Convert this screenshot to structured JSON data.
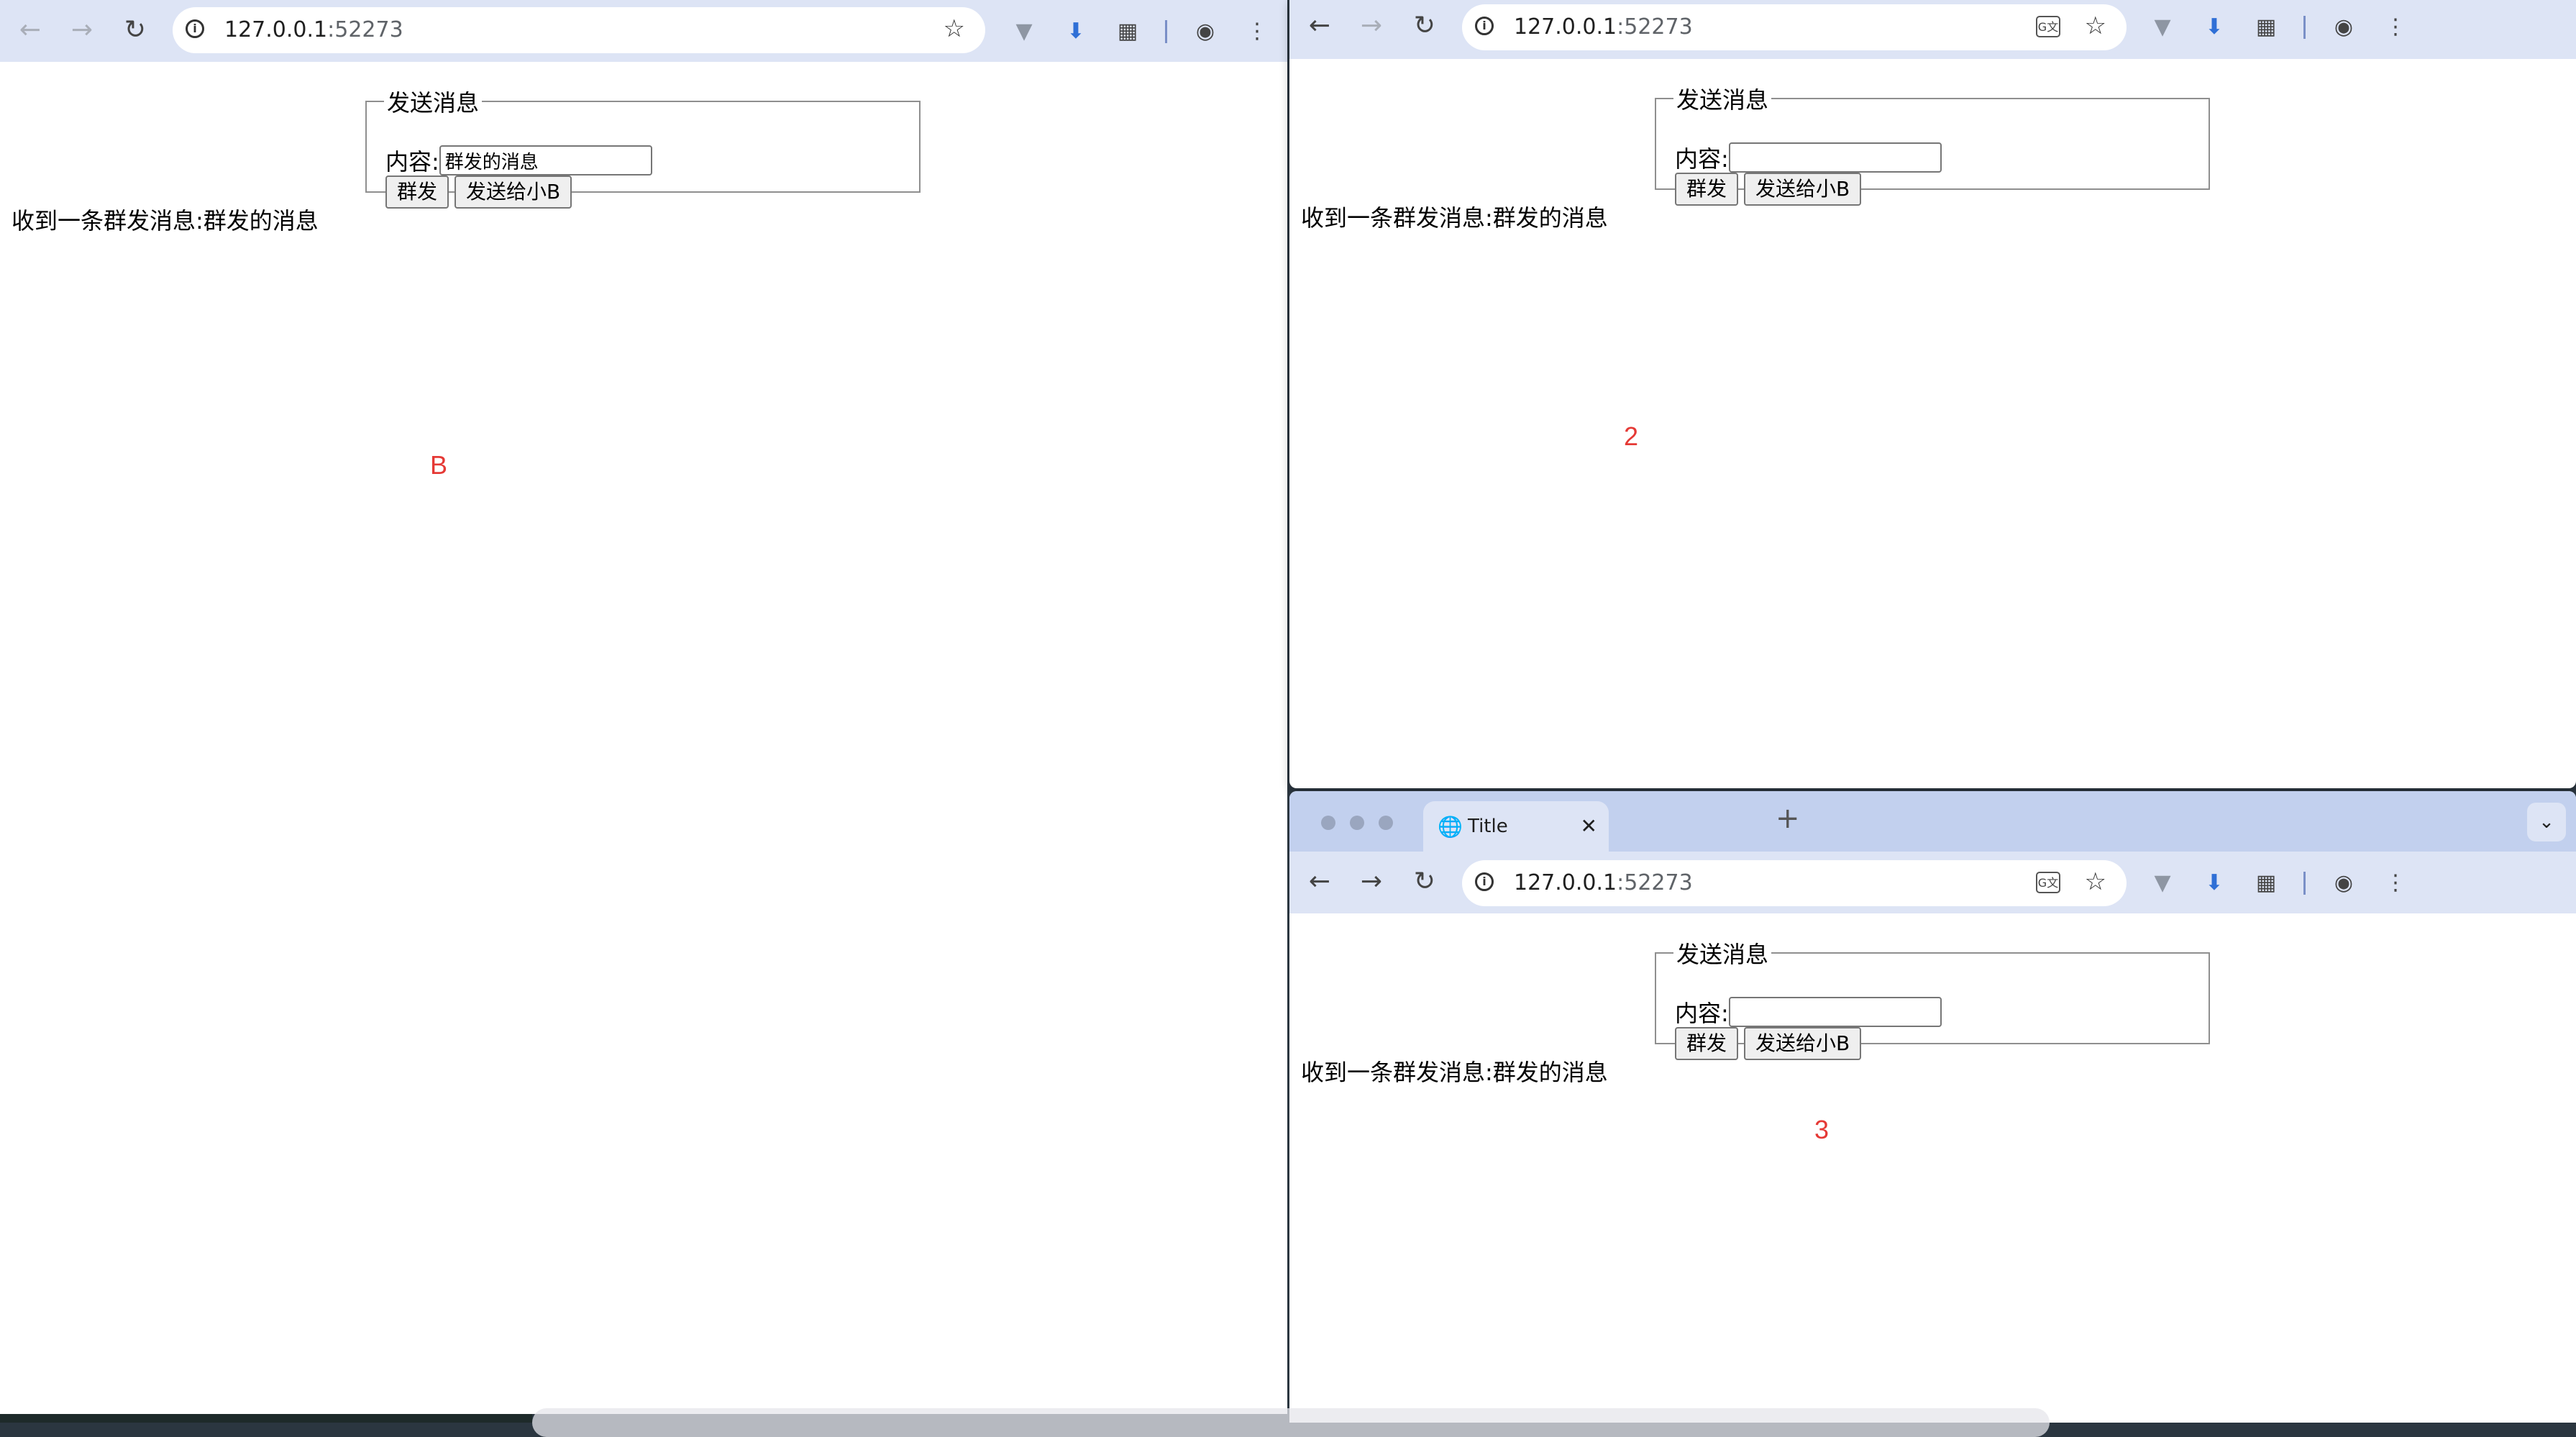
{
  "windows": {
    "a": {
      "url_host": "127.0.0.1",
      "url_port": ":52273",
      "fieldset_legend": "发送消息",
      "content_label": "内容:",
      "input_value": "群发的消息",
      "broadcast_button": "群发",
      "send_to_b_button": "发送给小B",
      "received_message": "收到一条群发消息:群发的消息",
      "marker": "B"
    },
    "b": {
      "url_host": "127.0.0.1",
      "url_port": ":52273",
      "fieldset_legend": "发送消息",
      "content_label": "内容:",
      "input_value": "",
      "broadcast_button": "群发",
      "send_to_b_button": "发送给小B",
      "received_message": "收到一条群发消息:群发的消息",
      "marker": "2"
    },
    "c": {
      "tab_title": "Title",
      "url_host": "127.0.0.1",
      "url_port": ":52273",
      "fieldset_legend": "发送消息",
      "content_label": "内容:",
      "input_value": "",
      "broadcast_button": "群发",
      "send_to_b_button": "发送给小B",
      "received_message": "收到一条群发消息:群发的消息",
      "marker": "3"
    }
  },
  "colors": {
    "toolbar": "#dde4f5",
    "tabstrip": "#c2d0ee",
    "marker": "#e53935"
  },
  "icons": [
    "back-arrow-icon",
    "forward-arrow-icon",
    "reload-icon",
    "info-icon",
    "star-icon",
    "translate-icon",
    "v-extension-icon",
    "download-extension-icon",
    "puzzle-extension-icon",
    "profile-icon",
    "kebab-menu-icon",
    "globe-icon",
    "close-icon",
    "plus-icon",
    "chevron-down-icon"
  ]
}
